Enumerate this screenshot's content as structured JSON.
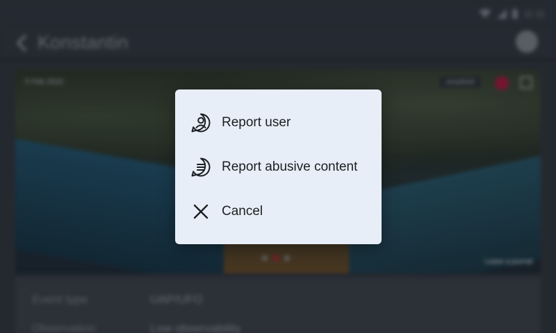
{
  "statusbar": {
    "time": "11:11",
    "wifi_icon": "wifi-icon",
    "signal_icon": "signal-icon",
    "battery_icon": "battery-icon"
  },
  "appbar": {
    "title": "Konstantin",
    "back_icon": "arrow-back-icon",
    "profile_icon": "profile-icon"
  },
  "photo": {
    "date": "5 Feb 2022",
    "status": "unsolved",
    "caption": "Leave a journal",
    "slide_count": 3,
    "active_slide": 2
  },
  "details": {
    "rows": [
      {
        "label": "Event type",
        "value": "UAP/UFO"
      },
      {
        "label": "Observation",
        "value": "Low observability"
      }
    ]
  },
  "dialog": {
    "items": [
      {
        "label": "Report user",
        "icon": "user-circle-icon"
      },
      {
        "label": "Report abusive content",
        "icon": "chat-bubble-lines-icon"
      },
      {
        "label": "Cancel",
        "icon": "close-icon"
      }
    ],
    "colors": {
      "background": "#e8eef7",
      "text": "#1b1e22"
    }
  }
}
